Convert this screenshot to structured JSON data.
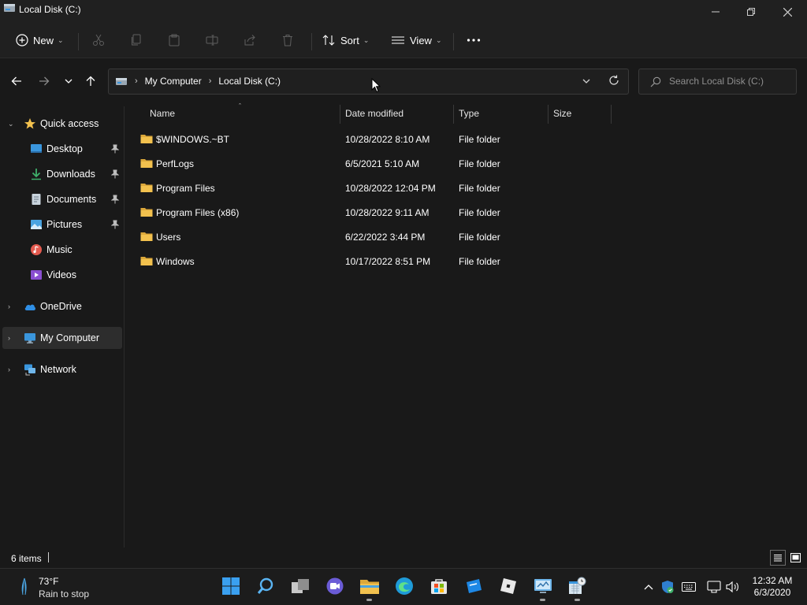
{
  "window": {
    "title": "Local Disk (C:)"
  },
  "toolbar": {
    "new_label": "New",
    "sort_label": "Sort",
    "view_label": "View"
  },
  "address": {
    "crumbs": [
      "My Computer",
      "Local Disk (C:)"
    ]
  },
  "search": {
    "placeholder": "Search Local Disk (C:)"
  },
  "sidebar": {
    "items": [
      {
        "label": "Quick access",
        "icon": "star-icon"
      },
      {
        "label": "Desktop",
        "icon": "desktop-icon",
        "pinned": true
      },
      {
        "label": "Downloads",
        "icon": "download-icon",
        "pinned": true
      },
      {
        "label": "Documents",
        "icon": "document-icon",
        "pinned": true
      },
      {
        "label": "Pictures",
        "icon": "pictures-icon",
        "pinned": true
      },
      {
        "label": "Music",
        "icon": "music-icon"
      },
      {
        "label": "Videos",
        "icon": "videos-icon"
      },
      {
        "label": "OneDrive",
        "icon": "cloud-icon"
      },
      {
        "label": "My Computer",
        "icon": "computer-icon",
        "selected": true
      },
      {
        "label": "Network",
        "icon": "network-icon"
      }
    ]
  },
  "columns": {
    "name": "Name",
    "date": "Date modified",
    "type": "Type",
    "size": "Size"
  },
  "files": [
    {
      "name": "$WINDOWS.~BT",
      "date": "10/28/2022 8:10 AM",
      "type": "File folder"
    },
    {
      "name": "PerfLogs",
      "date": "6/5/2021 5:10 AM",
      "type": "File folder"
    },
    {
      "name": "Program Files",
      "date": "10/28/2022 12:04 PM",
      "type": "File folder"
    },
    {
      "name": "Program Files (x86)",
      "date": "10/28/2022 9:11 AM",
      "type": "File folder"
    },
    {
      "name": "Users",
      "date": "6/22/2022 3:44 PM",
      "type": "File folder"
    },
    {
      "name": "Windows",
      "date": "10/17/2022 8:51 PM",
      "type": "File folder"
    }
  ],
  "status": {
    "item_count": "6 items"
  },
  "taskbar": {
    "weather_temp": "73°F",
    "weather_desc": "Rain to stop",
    "time": "12:32 AM",
    "date": "6/3/2020"
  },
  "colors": {
    "folder": "#f2c14e",
    "accent": "#3a96dd",
    "background": "#191919",
    "chrome": "#202020"
  }
}
